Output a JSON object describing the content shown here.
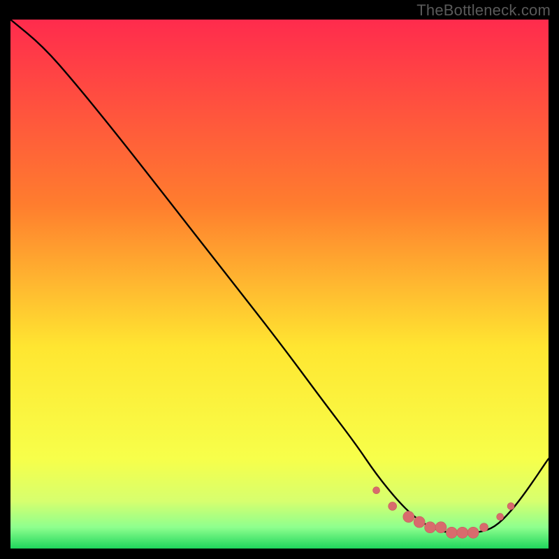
{
  "watermark": "TheBottleneck.com",
  "colors": {
    "gradient_top": "#ff2b4d",
    "gradient_mid_upper": "#ff7d2e",
    "gradient_mid": "#ffe631",
    "gradient_low1": "#f7ff4a",
    "gradient_low2": "#d7ff6e",
    "gradient_low3": "#8eff8e",
    "gradient_bottom": "#1fd65c",
    "curve": "#000000",
    "marker_fill": "#d86b6d",
    "marker_stroke": "#c85a5c"
  },
  "chart_data": {
    "type": "line",
    "title": "",
    "xlabel": "",
    "ylabel": "",
    "xlim": [
      0,
      100
    ],
    "ylim": [
      0,
      100
    ],
    "series": [
      {
        "name": "curve",
        "x": [
          0,
          6,
          12,
          20,
          30,
          40,
          50,
          58,
          64,
          68,
          72,
          75,
          78,
          81,
          84,
          87,
          90,
          93,
          96,
          100
        ],
        "y": [
          100,
          95,
          88,
          78,
          65,
          52,
          39,
          28,
          20,
          14,
          9,
          6,
          4,
          3,
          3,
          3,
          4,
          7,
          11,
          17
        ]
      }
    ],
    "markers": {
      "name": "highlight-points",
      "x": [
        68,
        71,
        74,
        76,
        78,
        80,
        82,
        84,
        86,
        88,
        91,
        93
      ],
      "y": [
        11,
        8,
        6,
        5,
        4,
        4,
        3,
        3,
        3,
        4,
        6,
        8
      ],
      "size": [
        5,
        6,
        8,
        8,
        8,
        8,
        8,
        8,
        8,
        6,
        5,
        5
      ]
    }
  }
}
